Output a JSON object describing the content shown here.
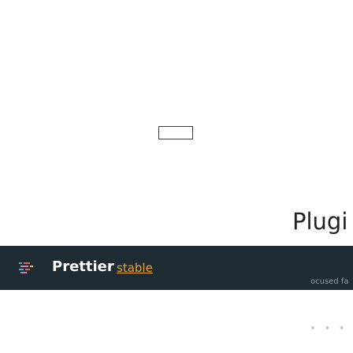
{
  "main": {
    "heading": "Plugi"
  },
  "prettier_bar": {
    "name": "Prettier",
    "version": "stable",
    "clipped_text": "ocused fa"
  },
  "footer": {
    "dots": "•••"
  },
  "colors": {
    "bar_background": "#1e2b32",
    "version_link": "#e7a436",
    "logo_stripes": [
      "#56b3b4",
      "#ea5e5e",
      "#bf85bf",
      "#f7ba3e"
    ]
  },
  "icons": {
    "logo": "prettier-logo-icon"
  }
}
